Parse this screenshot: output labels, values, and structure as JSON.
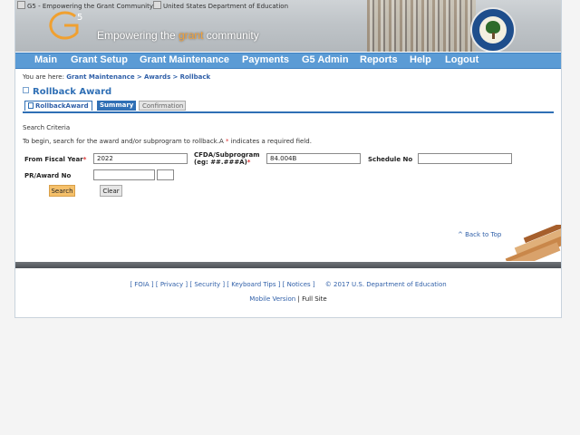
{
  "banner": {
    "logo_alt": "G5 - Empowering the Grant Community",
    "seal_alt": "United States Department of Education",
    "tagline_pre": "Empowering the ",
    "tagline_hl": "grant",
    "tagline_post": " community"
  },
  "nav": {
    "items": [
      "Main",
      "Grant Setup",
      "Grant Maintenance",
      "Payments",
      "G5 Admin",
      "Reports",
      "Help",
      "Logout"
    ]
  },
  "breadcrumb": {
    "prefix": "You are here:",
    "items": [
      "Grant Maintenance",
      "Awards",
      "Rollback"
    ],
    "sep": ">"
  },
  "page": {
    "title": "Rollback Award",
    "tabs": [
      "RollbackAward",
      "Summary",
      "Confirmation"
    ]
  },
  "search": {
    "section_label": "Search Criteria",
    "instructions_pre": "To begin, search for the award and/or subprogram to rollback.A ",
    "instructions_star": "*",
    "instructions_post": " indicates a required field.",
    "fiscal_year_label": "From Fiscal Year",
    "fiscal_year_value": "2022",
    "cfda_label_line1": "CFDA/Subprogram",
    "cfda_label_line2": "(eg: ##.###A)",
    "cfda_value": "84.004B",
    "schedule_label": "Schedule No",
    "schedule_value": "",
    "pr_award_label": "PR/Award No",
    "pr_award_value": "",
    "pr_award_suffix_value": "",
    "required_marker": "*",
    "search_button": "Search",
    "clear_button": "Clear"
  },
  "back_to_top": "^ Back to Top",
  "footer": {
    "links": [
      "FOIA",
      "Privacy",
      "Security",
      "Keyboard Tips",
      "Notices"
    ],
    "copyright": "© 2017 U.S. Department of Education",
    "mobile_version": "Mobile Version",
    "full_site": "Full Site",
    "divider": "|"
  }
}
